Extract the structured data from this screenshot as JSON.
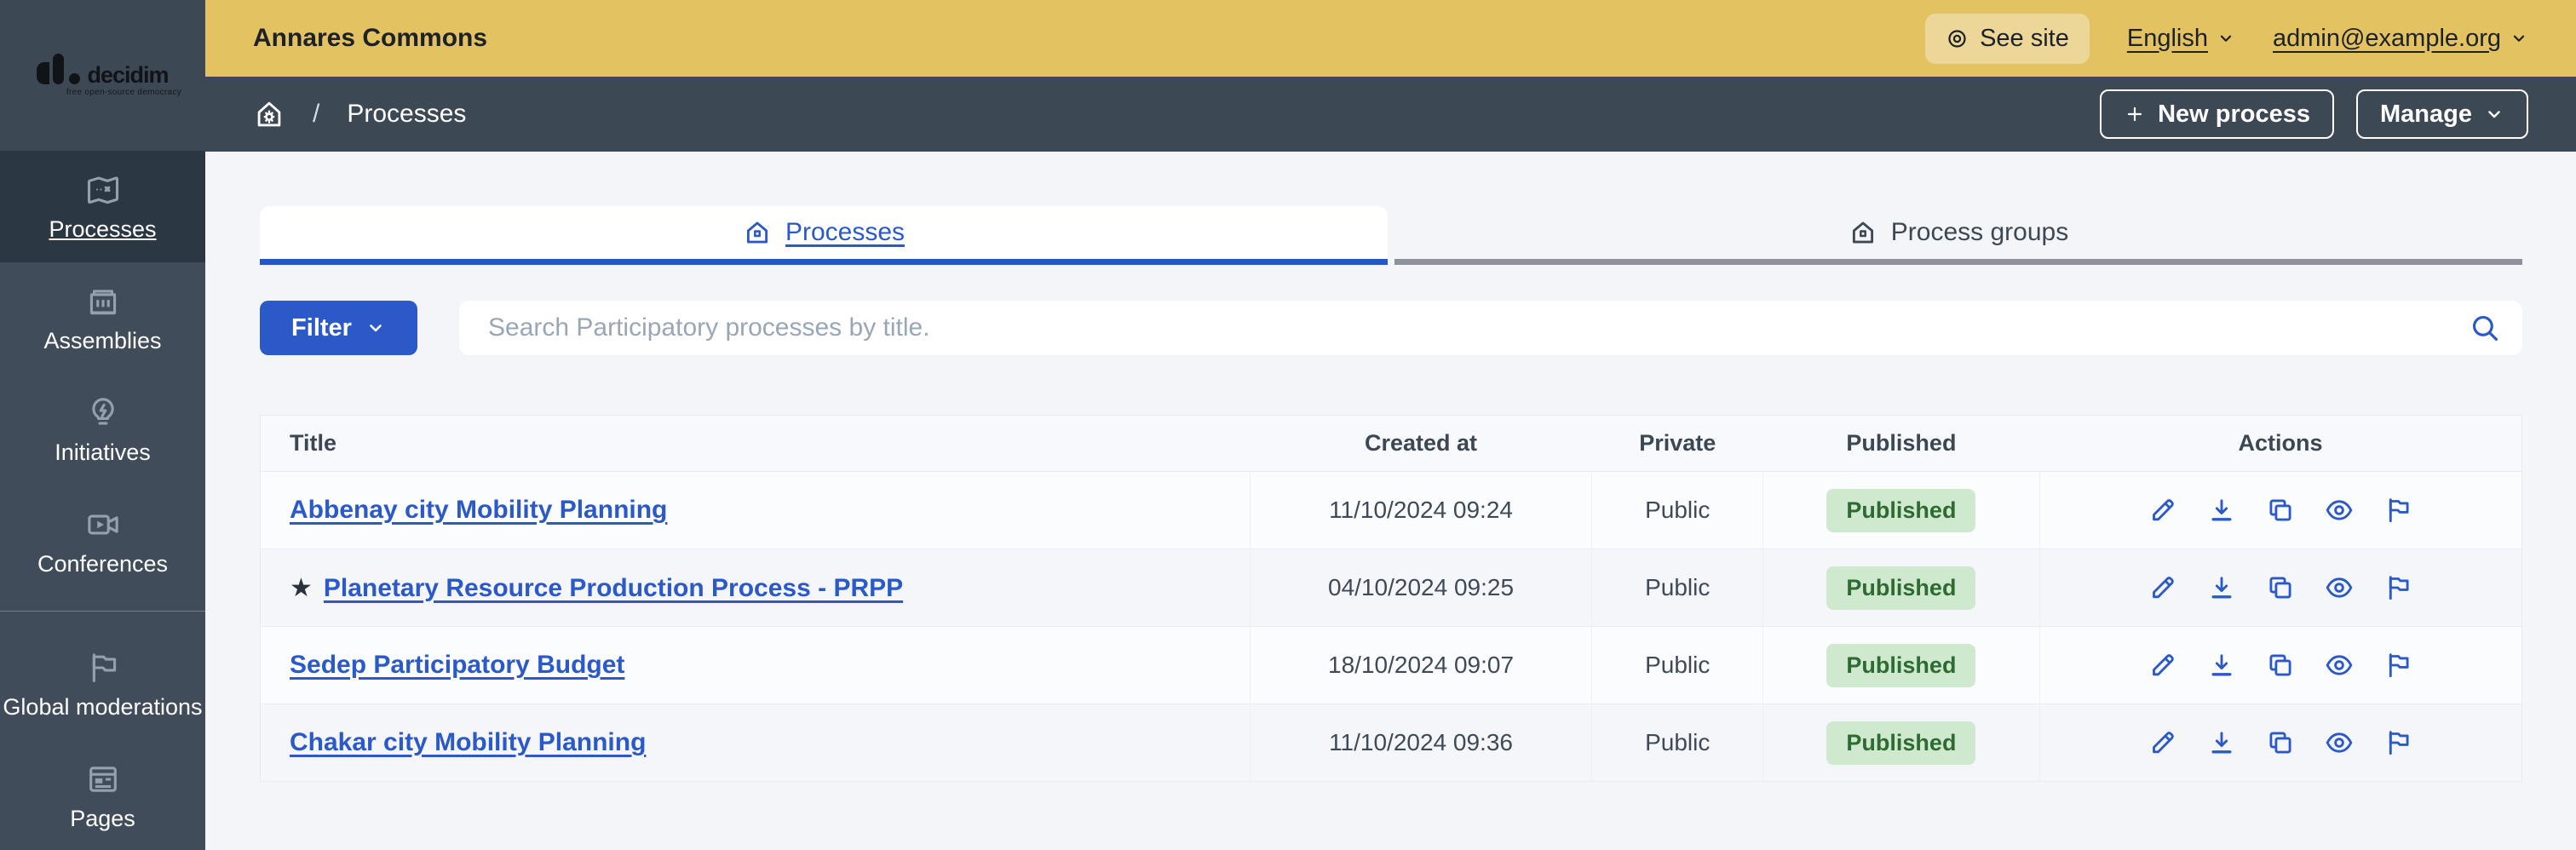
{
  "brand": {
    "logo_text": "decidim",
    "logo_tagline": "free open-source democracy"
  },
  "topbar": {
    "org_name": "Annares Commons",
    "see_site_label": "See site",
    "language_label": "English",
    "user_email": "admin@example.org"
  },
  "breadcrumb": {
    "separator": "/",
    "current_page": "Processes"
  },
  "toolbar": {
    "new_process_label": "New process",
    "manage_label": "Manage"
  },
  "sidebar": {
    "items": [
      {
        "label": "Processes",
        "icon": "map-icon",
        "active": true
      },
      {
        "label": "Assemblies",
        "icon": "government-building-icon",
        "active": false
      },
      {
        "label": "Initiatives",
        "icon": "lightbulb-flash-icon",
        "active": false
      },
      {
        "label": "Conferences",
        "icon": "video-camera-icon",
        "active": false
      },
      {
        "label": "Global moderations",
        "icon": "flag-icon",
        "active": false
      },
      {
        "label": "Pages",
        "icon": "page-layout-icon",
        "active": false
      }
    ]
  },
  "tabs": [
    {
      "label": "Processes",
      "icon": "house-icon",
      "active": true
    },
    {
      "label": "Process groups",
      "icon": "house-icon",
      "active": false
    }
  ],
  "filter": {
    "label": "Filter"
  },
  "search": {
    "placeholder": "Search Participatory processes by title."
  },
  "table": {
    "columns": [
      "Title",
      "Created at",
      "Private",
      "Published",
      "Actions"
    ],
    "action_icons": [
      "edit-pencil-icon",
      "export-download-icon",
      "duplicate-copy-icon",
      "preview-eye-icon",
      "moderation-flag-icon"
    ],
    "rows": [
      {
        "title": "Abbenay city Mobility Planning",
        "created_at": "11/10/2024 09:24",
        "private": "Public",
        "published": "Published"
      },
      {
        "title": "Planetary Resource Production Process - PRPP",
        "star": "★",
        "created_at": "04/10/2024 09:25",
        "private": "Public",
        "published": "Published"
      },
      {
        "title": "Sedep Participatory Budget",
        "created_at": "18/10/2024 09:07",
        "private": "Public",
        "published": "Published"
      },
      {
        "title": "Chakar city Mobility Planning",
        "created_at": "11/10/2024 09:36",
        "private": "Public",
        "published": "Published"
      }
    ]
  },
  "colors": {
    "topbar_yellow": "#e3c262",
    "dark_slate": "#3d4855",
    "sidebar_slate": "#414c5b",
    "sidebar_active": "#2c3744",
    "accent_blue": "#2b59c8",
    "badge_green_bg": "#cfe9cf",
    "badge_green_text": "#2e6b33",
    "page_background": "#f3f5f8"
  }
}
